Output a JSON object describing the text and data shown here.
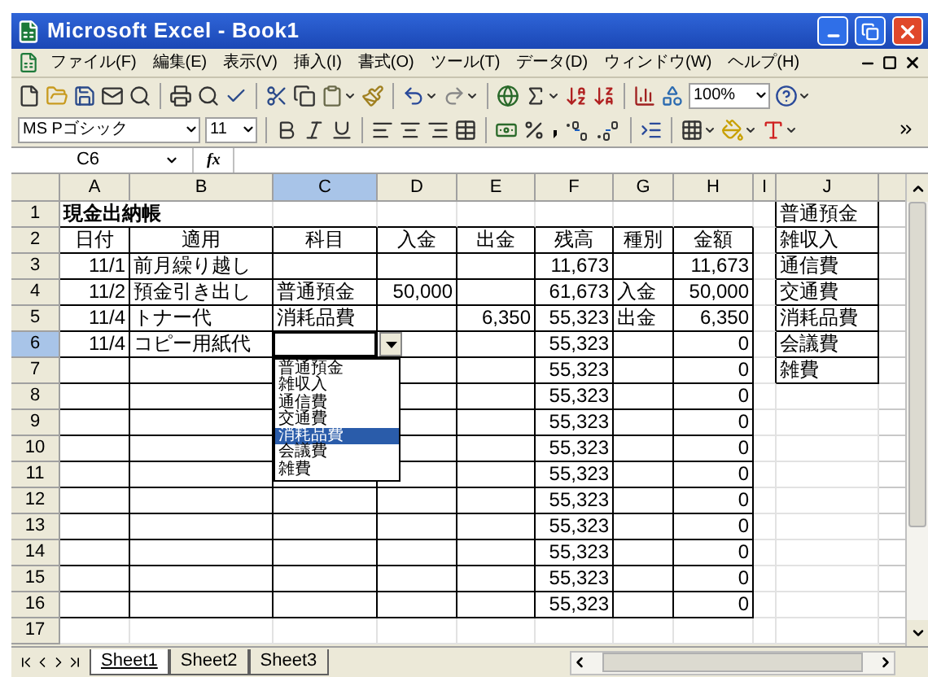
{
  "window": {
    "title": "Microsoft Excel - Book1"
  },
  "menu": [
    "ファイル(F)",
    "編集(E)",
    "表示(V)",
    "挿入(I)",
    "書式(O)",
    "ツール(T)",
    "データ(D)",
    "ウィンドウ(W)",
    "ヘルプ(H)"
  ],
  "standard_toolbar": {
    "zoom": "100%"
  },
  "format_toolbar": {
    "font": "MS Pゴシック",
    "size": "11"
  },
  "formula_bar": {
    "name_box": "C6",
    "function_label": "fx"
  },
  "columns": [
    {
      "label": "A",
      "selected": false
    },
    {
      "label": "B",
      "selected": false
    },
    {
      "label": "C",
      "selected": true
    },
    {
      "label": "D",
      "selected": false
    },
    {
      "label": "E",
      "selected": false
    },
    {
      "label": "F",
      "selected": false
    },
    {
      "label": "G",
      "selected": false
    },
    {
      "label": "H",
      "selected": false
    },
    {
      "label": "I",
      "selected": false
    },
    {
      "label": "J",
      "selected": false
    }
  ],
  "rows": [
    {
      "number": "1",
      "selected": false,
      "cells": [
        {
          "kind": "title",
          "text": "現金出納帳"
        },
        {
          "kind": "covered"
        },
        {
          "kind": "blank"
        },
        {
          "kind": "blank"
        },
        {
          "kind": "blank"
        },
        {
          "kind": "blank"
        },
        {
          "kind": "blank"
        },
        {
          "kind": "blank"
        },
        {
          "kind": "blank"
        },
        {
          "kind": "text",
          "text": "普通預金"
        }
      ]
    },
    {
      "number": "2",
      "selected": false,
      "cells": [
        {
          "kind": "heading",
          "text": "日付"
        },
        {
          "kind": "heading",
          "text": "適用"
        },
        {
          "kind": "heading",
          "text": "科目"
        },
        {
          "kind": "heading",
          "text": "入金"
        },
        {
          "kind": "heading",
          "text": "出金"
        },
        {
          "kind": "heading",
          "text": "残高"
        },
        {
          "kind": "heading",
          "text": "種別"
        },
        {
          "kind": "heading",
          "text": "金額"
        },
        {
          "kind": "blank"
        },
        {
          "kind": "text",
          "text": "雑収入"
        }
      ]
    },
    {
      "number": "3",
      "selected": false,
      "cells": [
        {
          "kind": "number",
          "text": "11/1"
        },
        {
          "kind": "text",
          "text": "前月繰り越し"
        },
        {
          "kind": "box"
        },
        {
          "kind": "box"
        },
        {
          "kind": "box"
        },
        {
          "kind": "number",
          "text": "11,673"
        },
        {
          "kind": "box"
        },
        {
          "kind": "number",
          "text": "11,673"
        },
        {
          "kind": "blank"
        },
        {
          "kind": "text",
          "text": "通信費"
        }
      ]
    },
    {
      "number": "4",
      "selected": false,
      "cells": [
        {
          "kind": "number",
          "text": "11/2"
        },
        {
          "kind": "text",
          "text": "預金引き出し"
        },
        {
          "kind": "text",
          "text": "普通預金"
        },
        {
          "kind": "number",
          "text": "50,000"
        },
        {
          "kind": "box"
        },
        {
          "kind": "number",
          "text": "61,673"
        },
        {
          "kind": "text",
          "text": "入金"
        },
        {
          "kind": "number",
          "text": "50,000"
        },
        {
          "kind": "blank"
        },
        {
          "kind": "text",
          "text": "交通費"
        }
      ]
    },
    {
      "number": "5",
      "selected": false,
      "cells": [
        {
          "kind": "number",
          "text": "11/4"
        },
        {
          "kind": "text",
          "text": "トナー代"
        },
        {
          "kind": "text",
          "text": "消耗品費"
        },
        {
          "kind": "box"
        },
        {
          "kind": "number",
          "text": "6,350"
        },
        {
          "kind": "number",
          "text": "55,323"
        },
        {
          "kind": "text",
          "text": "出金"
        },
        {
          "kind": "number",
          "text": "6,350"
        },
        {
          "kind": "blank"
        },
        {
          "kind": "text",
          "text": "消耗品費"
        }
      ]
    },
    {
      "number": "6",
      "selected": true,
      "cells": [
        {
          "kind": "number",
          "text": "11/4"
        },
        {
          "kind": "text",
          "text": "コピー用紙代"
        },
        {
          "kind": "dropdown",
          "items": [
            {
              "label": "普通預金",
              "selected": false
            },
            {
              "label": "雑収入",
              "selected": false
            },
            {
              "label": "通信費",
              "selected": false
            },
            {
              "label": "交通費",
              "selected": false
            },
            {
              "label": "消耗品費",
              "selected": true
            },
            {
              "label": "会議費",
              "selected": false
            },
            {
              "label": "雑費",
              "selected": false
            }
          ]
        },
        {
          "kind": "box"
        },
        {
          "kind": "box"
        },
        {
          "kind": "number",
          "text": "55,323"
        },
        {
          "kind": "box"
        },
        {
          "kind": "number",
          "text": "0"
        },
        {
          "kind": "blank"
        },
        {
          "kind": "text",
          "text": "会議費"
        }
      ]
    },
    {
      "number": "7",
      "selected": false,
      "cells": [
        {
          "kind": "box"
        },
        {
          "kind": "box"
        },
        {
          "kind": "under_list"
        },
        {
          "kind": "box"
        },
        {
          "kind": "box"
        },
        {
          "kind": "number",
          "text": "55,323"
        },
        {
          "kind": "box"
        },
        {
          "kind": "number",
          "text": "0"
        },
        {
          "kind": "blank"
        },
        {
          "kind": "text",
          "text": "雑費"
        }
      ]
    },
    {
      "number": "8",
      "selected": false,
      "cells": [
        {
          "kind": "box"
        },
        {
          "kind": "box"
        },
        {
          "kind": "under_list"
        },
        {
          "kind": "box"
        },
        {
          "kind": "box"
        },
        {
          "kind": "number",
          "text": "55,323"
        },
        {
          "kind": "box"
        },
        {
          "kind": "number",
          "text": "0"
        },
        {
          "kind": "blank"
        },
        {
          "kind": "blank"
        }
      ]
    },
    {
      "number": "9",
      "selected": false,
      "cells": [
        {
          "kind": "box"
        },
        {
          "kind": "box"
        },
        {
          "kind": "under_list"
        },
        {
          "kind": "box"
        },
        {
          "kind": "box"
        },
        {
          "kind": "number",
          "text": "55,323"
        },
        {
          "kind": "box"
        },
        {
          "kind": "number",
          "text": "0"
        },
        {
          "kind": "blank"
        },
        {
          "kind": "blank"
        }
      ]
    },
    {
      "number": "10",
      "selected": false,
      "cells": [
        {
          "kind": "box"
        },
        {
          "kind": "box"
        },
        {
          "kind": "under_list"
        },
        {
          "kind": "box"
        },
        {
          "kind": "box"
        },
        {
          "kind": "number",
          "text": "55,323"
        },
        {
          "kind": "box"
        },
        {
          "kind": "number",
          "text": "0"
        },
        {
          "kind": "blank"
        },
        {
          "kind": "blank"
        }
      ]
    },
    {
      "number": "11",
      "selected": false,
      "cells": [
        {
          "kind": "box"
        },
        {
          "kind": "box"
        },
        {
          "kind": "box"
        },
        {
          "kind": "box"
        },
        {
          "kind": "box"
        },
        {
          "kind": "number",
          "text": "55,323"
        },
        {
          "kind": "box"
        },
        {
          "kind": "number",
          "text": "0"
        },
        {
          "kind": "blank"
        },
        {
          "kind": "blank"
        }
      ]
    },
    {
      "number": "12",
      "selected": false,
      "cells": [
        {
          "kind": "box"
        },
        {
          "kind": "box"
        },
        {
          "kind": "box"
        },
        {
          "kind": "box"
        },
        {
          "kind": "box"
        },
        {
          "kind": "number",
          "text": "55,323"
        },
        {
          "kind": "box"
        },
        {
          "kind": "number",
          "text": "0"
        },
        {
          "kind": "blank"
        },
        {
          "kind": "blank"
        }
      ]
    },
    {
      "number": "13",
      "selected": false,
      "cells": [
        {
          "kind": "box"
        },
        {
          "kind": "box"
        },
        {
          "kind": "box"
        },
        {
          "kind": "box"
        },
        {
          "kind": "box"
        },
        {
          "kind": "number",
          "text": "55,323"
        },
        {
          "kind": "box"
        },
        {
          "kind": "number",
          "text": "0"
        },
        {
          "kind": "blank"
        },
        {
          "kind": "blank"
        }
      ]
    },
    {
      "number": "14",
      "selected": false,
      "cells": [
        {
          "kind": "box"
        },
        {
          "kind": "box"
        },
        {
          "kind": "box"
        },
        {
          "kind": "box"
        },
        {
          "kind": "box"
        },
        {
          "kind": "number",
          "text": "55,323"
        },
        {
          "kind": "box"
        },
        {
          "kind": "number",
          "text": "0"
        },
        {
          "kind": "blank"
        },
        {
          "kind": "blank"
        }
      ]
    },
    {
      "number": "15",
      "selected": false,
      "cells": [
        {
          "kind": "box"
        },
        {
          "kind": "box"
        },
        {
          "kind": "box"
        },
        {
          "kind": "box"
        },
        {
          "kind": "box"
        },
        {
          "kind": "number",
          "text": "55,323"
        },
        {
          "kind": "box"
        },
        {
          "kind": "number",
          "text": "0"
        },
        {
          "kind": "blank"
        },
        {
          "kind": "blank"
        }
      ]
    },
    {
      "number": "16",
      "selected": false,
      "cells": [
        {
          "kind": "box"
        },
        {
          "kind": "box"
        },
        {
          "kind": "box"
        },
        {
          "kind": "box"
        },
        {
          "kind": "box"
        },
        {
          "kind": "number",
          "text": "55,323"
        },
        {
          "kind": "box"
        },
        {
          "kind": "number",
          "text": "0"
        },
        {
          "kind": "blank"
        },
        {
          "kind": "blank"
        }
      ]
    },
    {
      "number": "17",
      "selected": false,
      "cells": [
        {
          "kind": "blank"
        },
        {
          "kind": "blank"
        },
        {
          "kind": "blank"
        },
        {
          "kind": "blank"
        },
        {
          "kind": "blank"
        },
        {
          "kind": "blank"
        },
        {
          "kind": "blank"
        },
        {
          "kind": "blank"
        },
        {
          "kind": "blank"
        },
        {
          "kind": "blank"
        }
      ]
    }
  ],
  "sheet_tabs": [
    {
      "label": "Sheet1",
      "selected": true
    },
    {
      "label": "Sheet2",
      "selected": false
    },
    {
      "label": "Sheet3",
      "selected": false
    }
  ]
}
